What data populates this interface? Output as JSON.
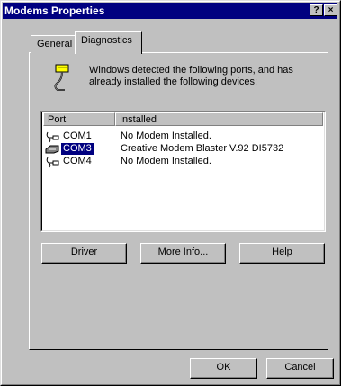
{
  "window": {
    "title": "Modems Properties",
    "help_button": "?",
    "close_button": "×"
  },
  "tabs": [
    {
      "label": "General",
      "active": false
    },
    {
      "label": "Diagnostics",
      "active": true
    }
  ],
  "info": {
    "icon": "modem-icon",
    "text": "Windows detected the following ports, and has already installed the following devices:"
  },
  "list": {
    "columns": [
      "Port",
      "Installed"
    ],
    "rows": [
      {
        "icon": "port-icon",
        "port": "COM1",
        "installed": "No Modem Installed.",
        "selected": false
      },
      {
        "icon": "modem-port-icon",
        "port": "COM3",
        "installed": "Creative Modem Blaster V.92 DI5732",
        "selected": true
      },
      {
        "icon": "port-icon",
        "port": "COM4",
        "installed": "No Modem Installed.",
        "selected": false
      }
    ]
  },
  "buttons": {
    "driver": {
      "pre": "",
      "key": "D",
      "post": "river"
    },
    "more_info": {
      "pre": "",
      "key": "M",
      "post": "ore Info..."
    },
    "help": {
      "pre": "",
      "key": "H",
      "post": "elp"
    },
    "ok": "OK",
    "cancel": "Cancel"
  },
  "colors": {
    "titlebar": "#000080",
    "face": "#c0c0c0",
    "selection": "#000080"
  }
}
